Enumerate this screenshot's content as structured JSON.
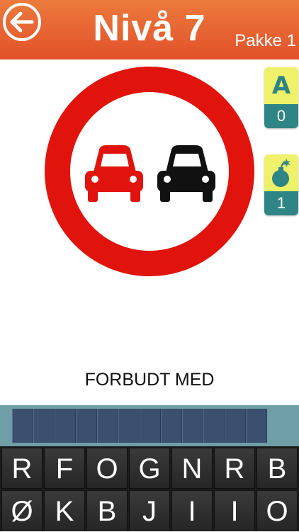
{
  "header": {
    "title": "Nivå 7",
    "pack": "Pakke 1",
    "back_icon": "arrow-left-circle-icon",
    "color_top": "#ec7a3c",
    "color_bottom": "#e2512a"
  },
  "sign": {
    "description_icon": "no-overtaking-sign",
    "ring_color": "#e0140c",
    "car_left_color": "#e0140c",
    "car_right_color": "#111111"
  },
  "hints": {
    "letter": {
      "glyph": "A",
      "count": "0",
      "icon": "letter-a-icon"
    },
    "bomb": {
      "count": "1",
      "icon": "bomb-icon"
    },
    "accent": "#2f8585",
    "background": "#eef169"
  },
  "clue_text": "FORBUDT MED",
  "answer_slots": 12,
  "keyboard": {
    "row1": [
      "R",
      "F",
      "O",
      "G",
      "N",
      "R",
      "B"
    ],
    "row2": [
      "Ø",
      "K",
      "B",
      "J",
      "I",
      "I",
      "O"
    ]
  }
}
